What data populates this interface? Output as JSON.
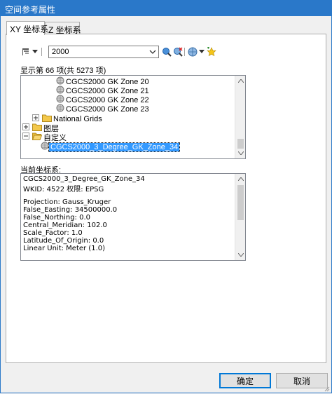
{
  "window": {
    "title": "空间参考属性"
  },
  "tabs": [
    {
      "label": "XY 坐标系",
      "active": true
    },
    {
      "label": "Z 坐标系",
      "active": false
    }
  ],
  "toolbar": {
    "filter_icon": "filter-icon",
    "search_value": "2000",
    "search_button_icon": "search-globe-icon",
    "clear_button_icon": "clear-search-icon",
    "add_icon": "globe-add-icon",
    "favorite_icon": "star-icon"
  },
  "tree": {
    "count_label": "显示第 66 项(共 5273 项)",
    "items": [
      {
        "label": "CGCS2000 GK Zone 20",
        "kind": "crs"
      },
      {
        "label": "CGCS2000 GK Zone 21",
        "kind": "crs"
      },
      {
        "label": "CGCS2000 GK Zone 22",
        "kind": "crs"
      },
      {
        "label": "CGCS2000 GK Zone 23",
        "kind": "crs"
      },
      {
        "label": "National Grids",
        "kind": "folder",
        "expander": "+"
      },
      {
        "label": "图层",
        "kind": "folder",
        "expander": "+"
      },
      {
        "label": "自定义",
        "kind": "folder-open",
        "expander": "−"
      },
      {
        "label": "CGCS2000_3_Degree_GK_Zone_34",
        "kind": "crs",
        "selected": true
      }
    ]
  },
  "current": {
    "label": "当前坐标系:",
    "lines": [
      "CGCS2000_3_Degree_GK_Zone_34",
      "WKID: 4522 权限: EPSG",
      "",
      "Projection: Gauss_Kruger",
      "False_Easting: 34500000.0",
      "False_Northing: 0.0",
      "Central_Meridian: 102.0",
      "Scale_Factor: 1.0",
      "Latitude_Of_Origin: 0.0",
      "Linear Unit: Meter (1.0)"
    ]
  },
  "buttons": {
    "ok": "确定",
    "cancel": "取消"
  },
  "colors": {
    "titlebar": "#2a78c9",
    "selection": "#3399ff",
    "default_button_border": "#0078d7"
  }
}
